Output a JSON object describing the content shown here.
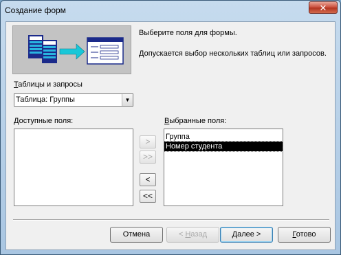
{
  "window": {
    "title": "Создание форм",
    "close_glyph": "✕"
  },
  "header": {
    "line1": "Выберите поля для формы.",
    "line2": "Допускается выбор нескольких таблиц или запросов."
  },
  "source": {
    "label": "Таблицы и запросы",
    "label_hotkey": "Т",
    "label_rest": "аблицы и запросы",
    "selected": "Таблица: Группы"
  },
  "available": {
    "label_hotkey": "Д",
    "label_rest": "оступные поля:",
    "items": []
  },
  "selected_fields": {
    "label_hotkey": "В",
    "label_rest": "ыбранные поля:",
    "items": [
      "Группа",
      "Номер студента"
    ],
    "highlighted_index": 1
  },
  "move_buttons": {
    "add_one": ">",
    "add_all": ">>",
    "remove_one": "<",
    "remove_all": "<<"
  },
  "buttons": {
    "cancel": "Отмена",
    "back_prefix": "< ",
    "back_hotkey": "Н",
    "back_rest": "азад",
    "next_hotkey": "Д",
    "next_rest": "алее >",
    "finish_hotkey": "Г",
    "finish_rest": "отово"
  },
  "icons": {
    "close": "close-icon",
    "combo_arrow": "chevron-down-icon",
    "banner": "wizard-illustration-icon"
  }
}
